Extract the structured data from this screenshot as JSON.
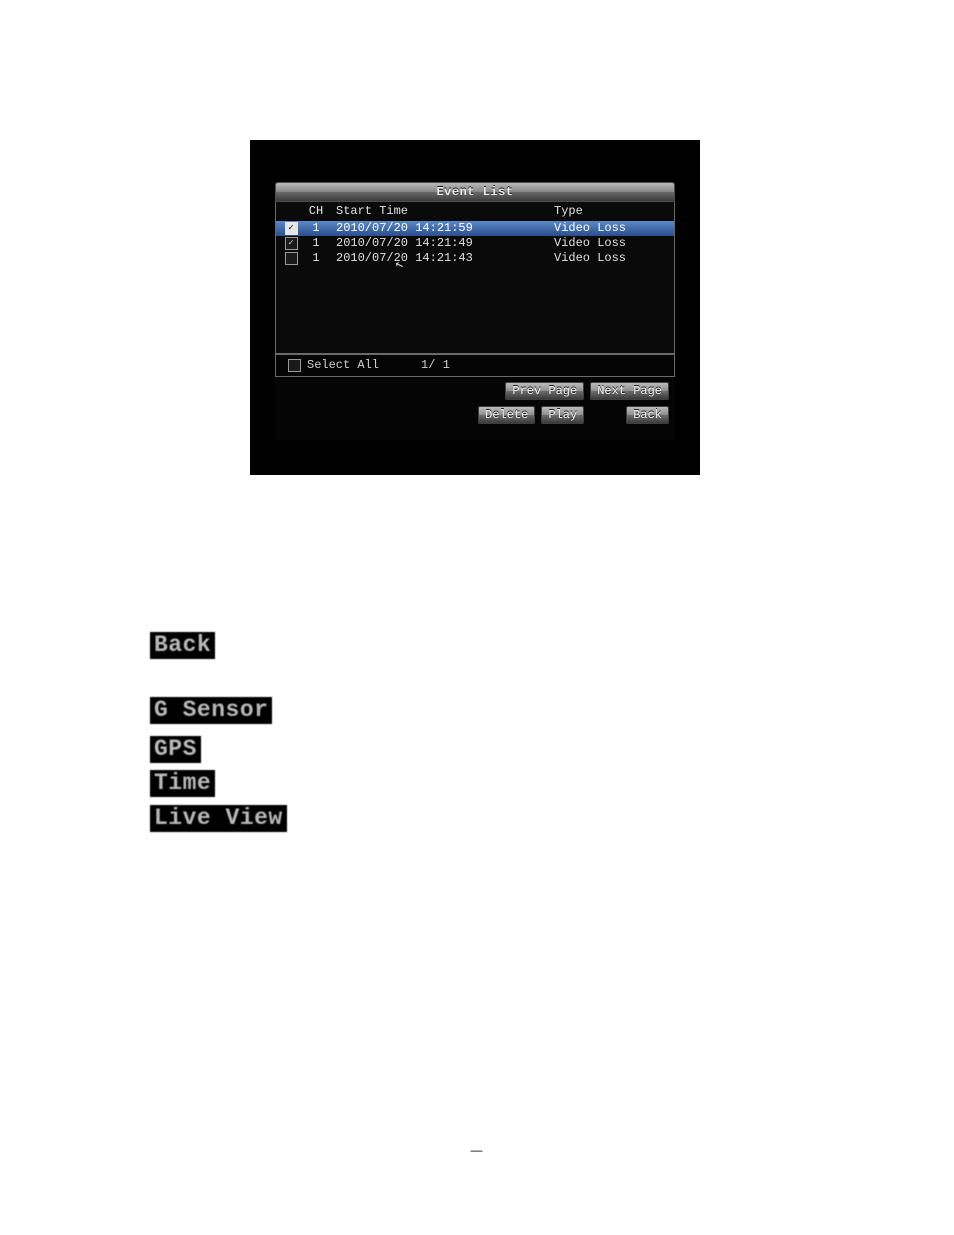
{
  "dialog": {
    "title": "Event List",
    "columns": {
      "ch": "CH",
      "start_time": "Start Time",
      "type": "Type"
    },
    "rows": [
      {
        "checked": true,
        "selected": true,
        "ch": "1",
        "start": "2010/07/20 14:21:59",
        "type": "Video Loss"
      },
      {
        "checked": true,
        "selected": false,
        "ch": "1",
        "start": "2010/07/20 14:21:49",
        "type": "Video Loss"
      },
      {
        "checked": false,
        "selected": false,
        "ch": "1",
        "start": "2010/07/20 14:21:43",
        "type": "Video Loss"
      }
    ],
    "select_all_label": "Select All",
    "page_indicator": "1/ 1",
    "buttons": {
      "prev": "Prev Page",
      "next": "Next Page",
      "delete": "Delete",
      "play": "Play",
      "back": "Back"
    }
  },
  "labels": {
    "back": "Back",
    "g_sensor": "G Sensor",
    "gps": "GPS",
    "time": "Time",
    "live_view": "Live View"
  },
  "page_number": "—"
}
